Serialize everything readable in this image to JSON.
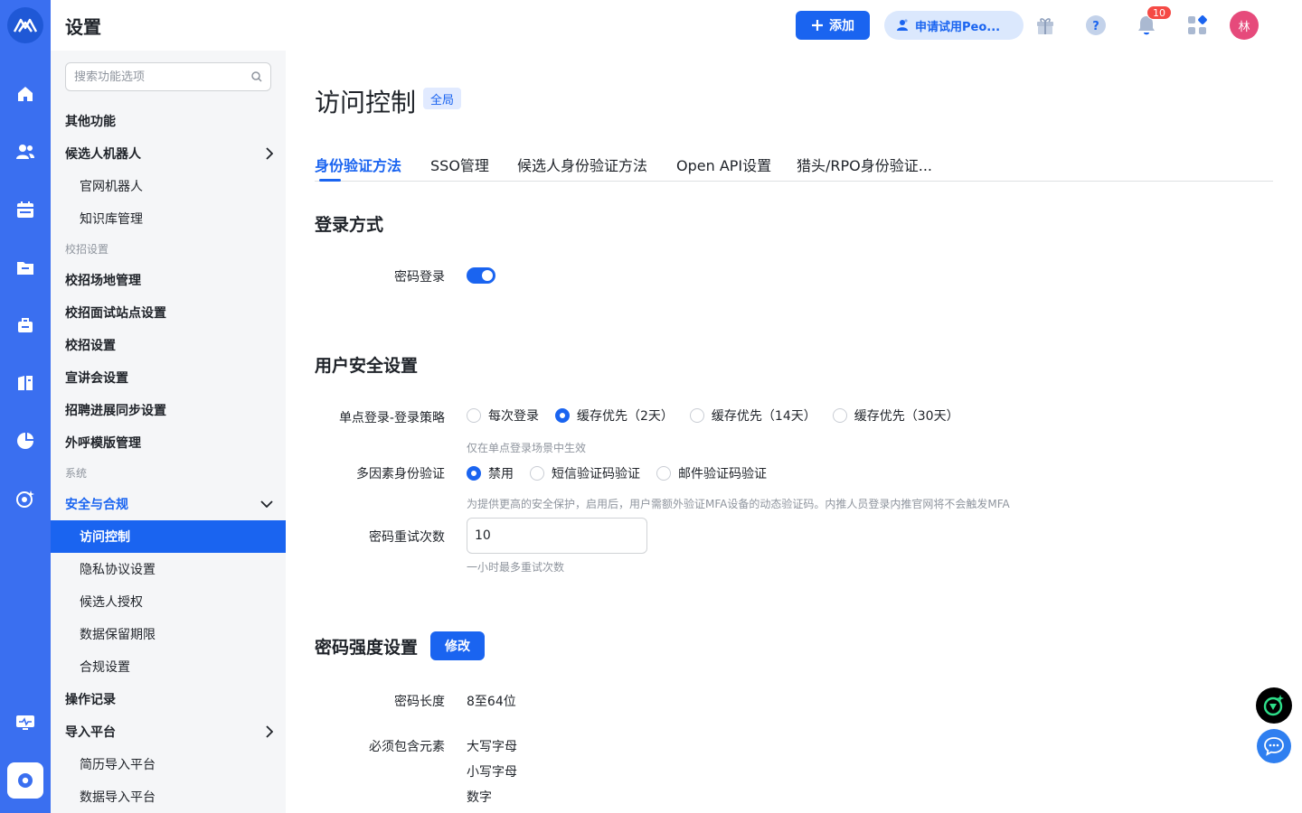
{
  "header": {
    "title": "设置",
    "add_label": "添加",
    "trial_label": "申请试用Peo...",
    "notification_count": "10",
    "avatar_initial": "林"
  },
  "sidebar": {
    "search_placeholder": "搜索功能选项",
    "items": [
      {
        "label": "其他功能"
      },
      {
        "label": "候选人机器人"
      },
      {
        "label": "官网机器人"
      },
      {
        "label": "知识库管理"
      },
      {
        "label": "校招设置"
      },
      {
        "label": "校招场地管理"
      },
      {
        "label": "校招面试站点设置"
      },
      {
        "label": "校招设置"
      },
      {
        "label": "宣讲会设置"
      },
      {
        "label": "招聘进展同步设置"
      },
      {
        "label": "外呼模版管理"
      },
      {
        "label": "系统"
      },
      {
        "label": "安全与合规"
      },
      {
        "label": "访问控制"
      },
      {
        "label": "隐私协议设置"
      },
      {
        "label": "候选人授权"
      },
      {
        "label": "数据保留期限"
      },
      {
        "label": "合规设置"
      },
      {
        "label": "操作记录"
      },
      {
        "label": "导入平台"
      },
      {
        "label": "简历导入平台"
      },
      {
        "label": "数据导入平台"
      }
    ]
  },
  "main": {
    "title": "访问控制",
    "scope_tag": "全局",
    "tabs": [
      {
        "label": "身份验证方法"
      },
      {
        "label": "SSO管理"
      },
      {
        "label": "候选人身份验证方法"
      },
      {
        "label": "Open API设置"
      },
      {
        "label": "猎头/RPO身份验证..."
      }
    ],
    "login": {
      "section_title": "登录方式",
      "password_login_label": "密码登录",
      "password_login_enabled": true
    },
    "security": {
      "section_title": "用户安全设置",
      "sso_label": "单点登录-登录策略",
      "sso_options": [
        "每次登录",
        "缓存优先（2天）",
        "缓存优先（14天）",
        "缓存优先（30天）"
      ],
      "sso_selected": "缓存优先（2天）",
      "sso_hint": "仅在单点登录场景中生效",
      "mfa_label": "多因素身份验证",
      "mfa_options": [
        "禁用",
        "短信验证码验证",
        "邮件验证码验证"
      ],
      "mfa_selected": "禁用",
      "mfa_hint": "为提供更高的安全保护，启用后，用户需额外验证MFA设备的动态验证码。内推人员登录内推官网将不会触发MFA",
      "retry_label": "密码重试次数",
      "retry_value": "10",
      "retry_hint": "一小时最多重试次数"
    },
    "strength": {
      "section_title": "密码强度设置",
      "edit_label": "修改",
      "length_label": "密码长度",
      "length_value": "8至64位",
      "elements_label": "必须包含元素",
      "elements": [
        "大写字母",
        "小写字母",
        "数字"
      ]
    }
  },
  "colors": {
    "rail": "#3a6ff0",
    "primary": "#1a64f0",
    "sidebar_bg": "#f5f6f8",
    "badge": "#f54a45",
    "avatar": "#e64a7b"
  }
}
